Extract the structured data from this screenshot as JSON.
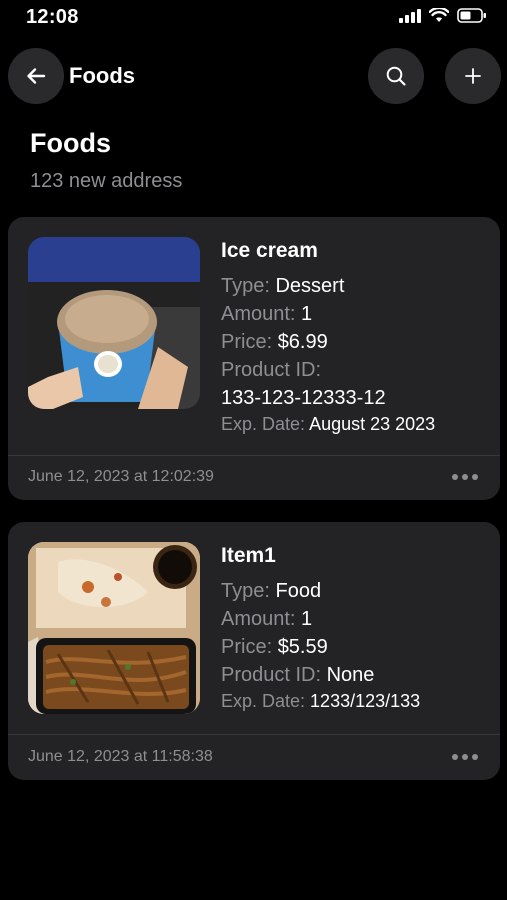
{
  "status_bar": {
    "time": "12:08"
  },
  "nav": {
    "title": "Foods"
  },
  "header": {
    "title": "Foods",
    "subtitle": "123 new address"
  },
  "labels": {
    "type": "Type: ",
    "amount": "Amount: ",
    "price": "Price: ",
    "product_id": "Product ID: ",
    "exp_date": "Exp. Date: "
  },
  "items": [
    {
      "name": "Ice cream",
      "type": "Dessert",
      "amount": "1",
      "price": "$6.99",
      "product_id": "133-123-12333-12",
      "exp_date": "August 23 2023",
      "timestamp": "June 12, 2023 at 12:02:39"
    },
    {
      "name": "Item1",
      "type": "Food",
      "amount": "1",
      "price": "$5.59",
      "product_id": "None",
      "exp_date": "1233/123/133",
      "timestamp": "June 12, 2023 at 11:58:38"
    }
  ],
  "icons": {
    "back": "arrow-left-icon",
    "search": "search-icon",
    "add": "plus-icon",
    "more": "ellipsis-icon"
  },
  "colors": {
    "background": "#000000",
    "card": "#232325",
    "button": "#2a2a2c",
    "secondary_text": "#8e8e93"
  }
}
